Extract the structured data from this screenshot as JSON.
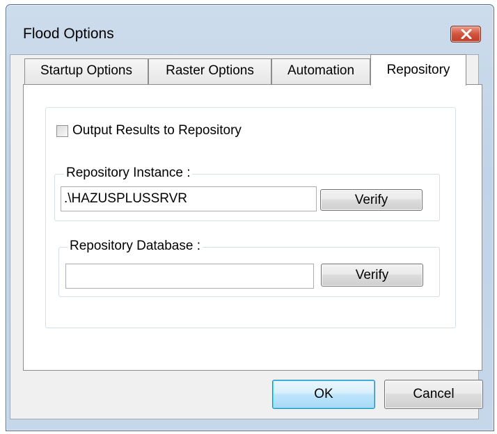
{
  "window": {
    "title": "Flood Options"
  },
  "tabs": [
    {
      "label": "Startup Options",
      "active": false
    },
    {
      "label": "Raster Options",
      "active": false
    },
    {
      "label": "Automation",
      "active": false
    },
    {
      "label": "Repository",
      "active": true
    }
  ],
  "repository": {
    "output_checkbox": {
      "label": "Output Results to Repository",
      "checked": false
    },
    "instance": {
      "label": "Repository Instance :",
      "value": ".\\HAZUSPLUSSRVR",
      "verify_label": "Verify"
    },
    "database": {
      "label": "Repository Database :",
      "value": "",
      "verify_label": "Verify"
    }
  },
  "buttons": {
    "ok": "OK",
    "cancel": "Cancel"
  }
}
